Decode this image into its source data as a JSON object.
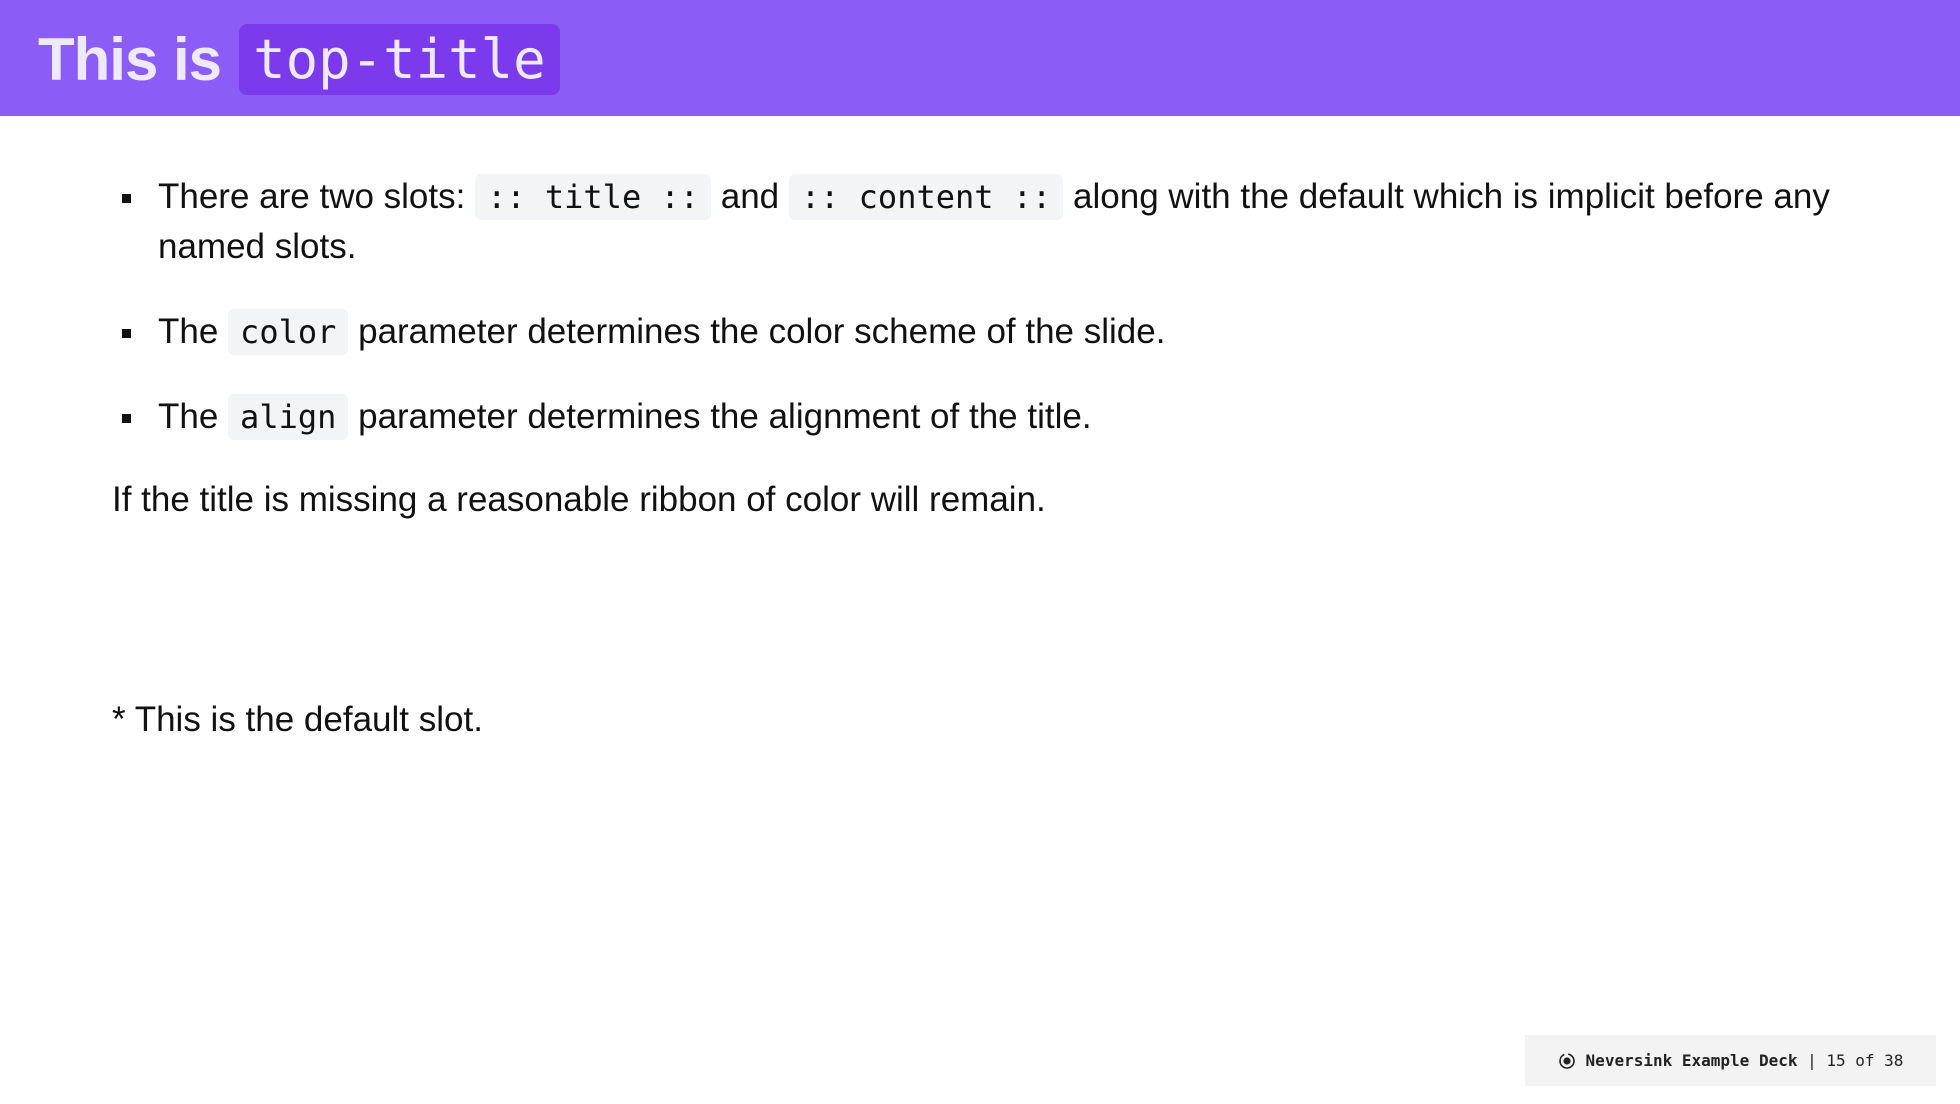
{
  "colors": {
    "ribbon": "#8b5cf6",
    "title_code_bg": "#7c3aed",
    "title_text": "#ede9fe"
  },
  "header": {
    "title_prefix": "This is",
    "title_code": "top-title"
  },
  "bullets": [
    {
      "t1": "There are two slots: ",
      "c1": ":: title ::",
      "t2": " and ",
      "c2": ":: content ::",
      "t3": " along with the default which is implicit before any named slots."
    },
    {
      "t1": "The ",
      "c1": "color",
      "t2": " parameter determines the color scheme of the slide."
    },
    {
      "t1": "The ",
      "c1": "align",
      "t2": " parameter determines the alignment of the title."
    }
  ],
  "paragraph": "If the title is missing a reasonable ribbon of color will remain.",
  "footnote": "* This is the default slot.",
  "footer": {
    "icon": "target-icon",
    "deck": "Neversink Example Deck",
    "separator": " | ",
    "page": "15 of 38"
  }
}
